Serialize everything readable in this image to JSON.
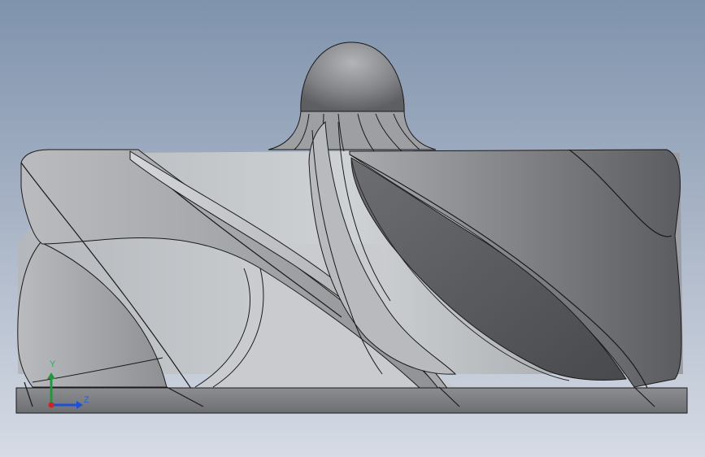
{
  "triad": {
    "y_label": "Y",
    "z_label": "Z",
    "x_color": "#d42020",
    "y_color": "#1e9a3c",
    "z_color": "#1f4fd6"
  },
  "colors": {
    "background_top": "#7f93ad",
    "background_bottom": "#d6dbe5",
    "part_light": "#c3c5c8",
    "part_dark": "#4c4d50",
    "edge": "#1a1a1a"
  }
}
